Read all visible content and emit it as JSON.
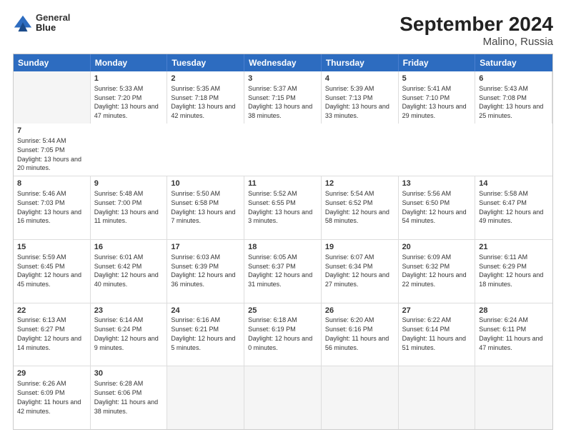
{
  "header": {
    "logo_line1": "General",
    "logo_line2": "Blue",
    "title": "September 2024",
    "subtitle": "Malino, Russia"
  },
  "days": [
    "Sunday",
    "Monday",
    "Tuesday",
    "Wednesday",
    "Thursday",
    "Friday",
    "Saturday"
  ],
  "rows": [
    [
      {
        "day": "",
        "empty": true
      },
      {
        "day": "1",
        "sunrise": "Sunrise: 5:33 AM",
        "sunset": "Sunset: 7:20 PM",
        "daylight": "Daylight: 13 hours and 47 minutes."
      },
      {
        "day": "2",
        "sunrise": "Sunrise: 5:35 AM",
        "sunset": "Sunset: 7:18 PM",
        "daylight": "Daylight: 13 hours and 42 minutes."
      },
      {
        "day": "3",
        "sunrise": "Sunrise: 5:37 AM",
        "sunset": "Sunset: 7:15 PM",
        "daylight": "Daylight: 13 hours and 38 minutes."
      },
      {
        "day": "4",
        "sunrise": "Sunrise: 5:39 AM",
        "sunset": "Sunset: 7:13 PM",
        "daylight": "Daylight: 13 hours and 33 minutes."
      },
      {
        "day": "5",
        "sunrise": "Sunrise: 5:41 AM",
        "sunset": "Sunset: 7:10 PM",
        "daylight": "Daylight: 13 hours and 29 minutes."
      },
      {
        "day": "6",
        "sunrise": "Sunrise: 5:43 AM",
        "sunset": "Sunset: 7:08 PM",
        "daylight": "Daylight: 13 hours and 25 minutes."
      },
      {
        "day": "7",
        "sunrise": "Sunrise: 5:44 AM",
        "sunset": "Sunset: 7:05 PM",
        "daylight": "Daylight: 13 hours and 20 minutes."
      }
    ],
    [
      {
        "day": "8",
        "sunrise": "Sunrise: 5:46 AM",
        "sunset": "Sunset: 7:03 PM",
        "daylight": "Daylight: 13 hours and 16 minutes."
      },
      {
        "day": "9",
        "sunrise": "Sunrise: 5:48 AM",
        "sunset": "Sunset: 7:00 PM",
        "daylight": "Daylight: 13 hours and 11 minutes."
      },
      {
        "day": "10",
        "sunrise": "Sunrise: 5:50 AM",
        "sunset": "Sunset: 6:58 PM",
        "daylight": "Daylight: 13 hours and 7 minutes."
      },
      {
        "day": "11",
        "sunrise": "Sunrise: 5:52 AM",
        "sunset": "Sunset: 6:55 PM",
        "daylight": "Daylight: 13 hours and 3 minutes."
      },
      {
        "day": "12",
        "sunrise": "Sunrise: 5:54 AM",
        "sunset": "Sunset: 6:52 PM",
        "daylight": "Daylight: 12 hours and 58 minutes."
      },
      {
        "day": "13",
        "sunrise": "Sunrise: 5:56 AM",
        "sunset": "Sunset: 6:50 PM",
        "daylight": "Daylight: 12 hours and 54 minutes."
      },
      {
        "day": "14",
        "sunrise": "Sunrise: 5:58 AM",
        "sunset": "Sunset: 6:47 PM",
        "daylight": "Daylight: 12 hours and 49 minutes."
      }
    ],
    [
      {
        "day": "15",
        "sunrise": "Sunrise: 5:59 AM",
        "sunset": "Sunset: 6:45 PM",
        "daylight": "Daylight: 12 hours and 45 minutes."
      },
      {
        "day": "16",
        "sunrise": "Sunrise: 6:01 AM",
        "sunset": "Sunset: 6:42 PM",
        "daylight": "Daylight: 12 hours and 40 minutes."
      },
      {
        "day": "17",
        "sunrise": "Sunrise: 6:03 AM",
        "sunset": "Sunset: 6:39 PM",
        "daylight": "Daylight: 12 hours and 36 minutes."
      },
      {
        "day": "18",
        "sunrise": "Sunrise: 6:05 AM",
        "sunset": "Sunset: 6:37 PM",
        "daylight": "Daylight: 12 hours and 31 minutes."
      },
      {
        "day": "19",
        "sunrise": "Sunrise: 6:07 AM",
        "sunset": "Sunset: 6:34 PM",
        "daylight": "Daylight: 12 hours and 27 minutes."
      },
      {
        "day": "20",
        "sunrise": "Sunrise: 6:09 AM",
        "sunset": "Sunset: 6:32 PM",
        "daylight": "Daylight: 12 hours and 22 minutes."
      },
      {
        "day": "21",
        "sunrise": "Sunrise: 6:11 AM",
        "sunset": "Sunset: 6:29 PM",
        "daylight": "Daylight: 12 hours and 18 minutes."
      }
    ],
    [
      {
        "day": "22",
        "sunrise": "Sunrise: 6:13 AM",
        "sunset": "Sunset: 6:27 PM",
        "daylight": "Daylight: 12 hours and 14 minutes."
      },
      {
        "day": "23",
        "sunrise": "Sunrise: 6:14 AM",
        "sunset": "Sunset: 6:24 PM",
        "daylight": "Daylight: 12 hours and 9 minutes."
      },
      {
        "day": "24",
        "sunrise": "Sunrise: 6:16 AM",
        "sunset": "Sunset: 6:21 PM",
        "daylight": "Daylight: 12 hours and 5 minutes."
      },
      {
        "day": "25",
        "sunrise": "Sunrise: 6:18 AM",
        "sunset": "Sunset: 6:19 PM",
        "daylight": "Daylight: 12 hours and 0 minutes."
      },
      {
        "day": "26",
        "sunrise": "Sunrise: 6:20 AM",
        "sunset": "Sunset: 6:16 PM",
        "daylight": "Daylight: 11 hours and 56 minutes."
      },
      {
        "day": "27",
        "sunrise": "Sunrise: 6:22 AM",
        "sunset": "Sunset: 6:14 PM",
        "daylight": "Daylight: 11 hours and 51 minutes."
      },
      {
        "day": "28",
        "sunrise": "Sunrise: 6:24 AM",
        "sunset": "Sunset: 6:11 PM",
        "daylight": "Daylight: 11 hours and 47 minutes."
      }
    ],
    [
      {
        "day": "29",
        "sunrise": "Sunrise: 6:26 AM",
        "sunset": "Sunset: 6:09 PM",
        "daylight": "Daylight: 11 hours and 42 minutes."
      },
      {
        "day": "30",
        "sunrise": "Sunrise: 6:28 AM",
        "sunset": "Sunset: 6:06 PM",
        "daylight": "Daylight: 11 hours and 38 minutes."
      },
      {
        "day": "",
        "empty": true
      },
      {
        "day": "",
        "empty": true
      },
      {
        "day": "",
        "empty": true
      },
      {
        "day": "",
        "empty": true
      },
      {
        "day": "",
        "empty": true
      }
    ]
  ]
}
